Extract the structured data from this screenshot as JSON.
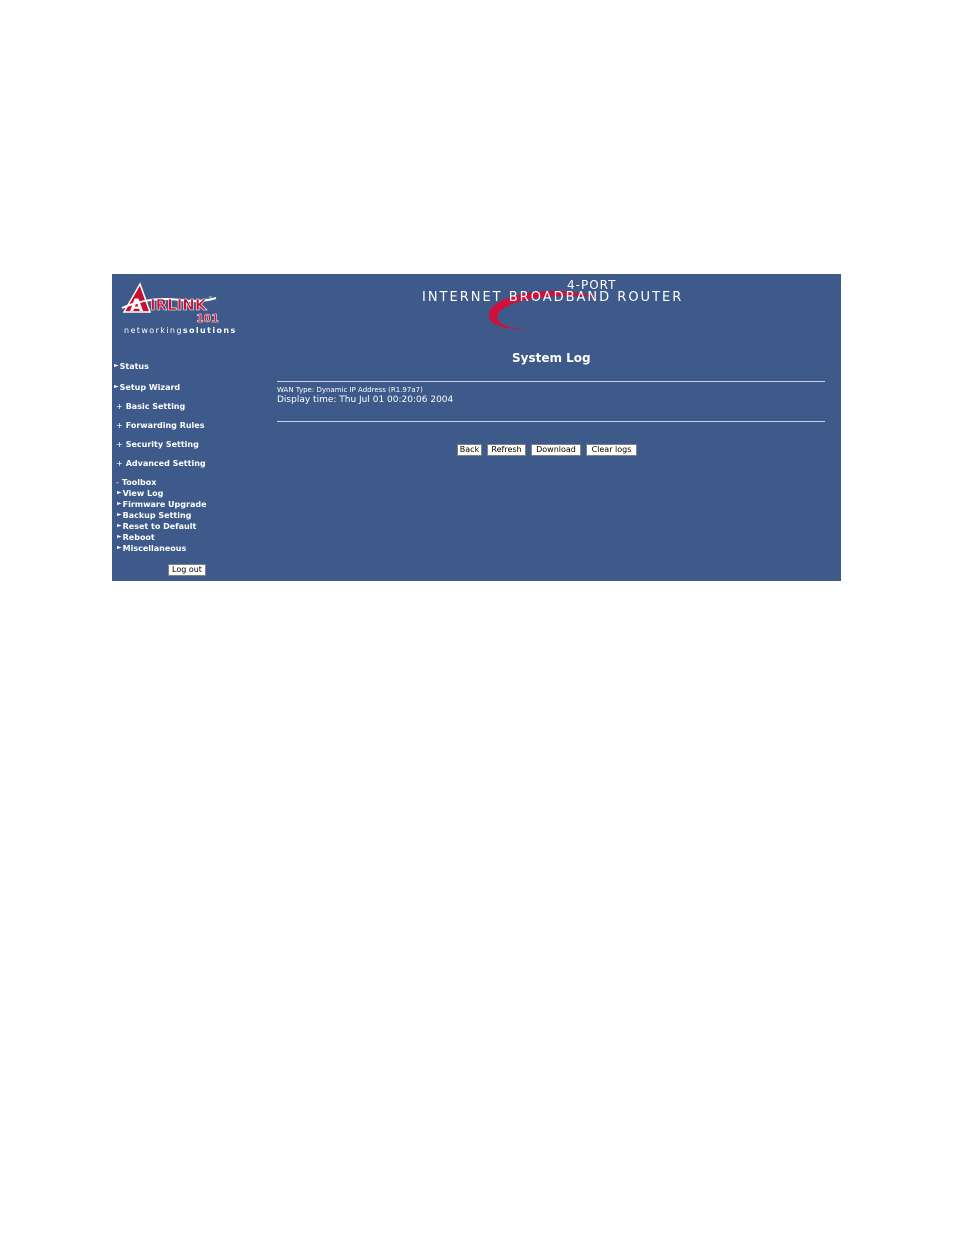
{
  "logo": {
    "brand_a": "A",
    "brand_rest": "IRLINK",
    "tm": "™",
    "number": "101",
    "tagline_light": "networking",
    "tagline_bold": "solutions"
  },
  "banner": {
    "port": "4-PORT",
    "product": "INTERNET BROADBAND ROUTER"
  },
  "sidebar": {
    "status": "Status",
    "setup_wizard": "Setup Wizard",
    "basic_setting": "Basic Setting",
    "forwarding_rules": "Forwarding Rules",
    "security_setting": "Security Setting",
    "advanced_setting": "Advanced Setting",
    "toolbox": "Toolbox",
    "plus": "+",
    "minus": "-",
    "toolbox_items": {
      "view_log": "View Log",
      "firmware_upgrade": "Firmware Upgrade",
      "backup_setting": "Backup Setting",
      "reset_to_default": "Reset to Default",
      "reboot": "Reboot",
      "miscellaneous": "Miscellaneous"
    },
    "logout": "Log out"
  },
  "main": {
    "title": "System Log",
    "wan_type": "WAN Type: Dynamic IP Address (R1.97a7)",
    "display_time": "Display time: Thu Jul 01 00:20:06 2004",
    "buttons": {
      "back": "Back",
      "refresh": "Refresh",
      "download": "Download",
      "clear_logs": "Clear logs"
    }
  },
  "colors": {
    "background": "#3e5a8a",
    "swoosh": "#d0103a",
    "logo_red": "#c8102e"
  }
}
